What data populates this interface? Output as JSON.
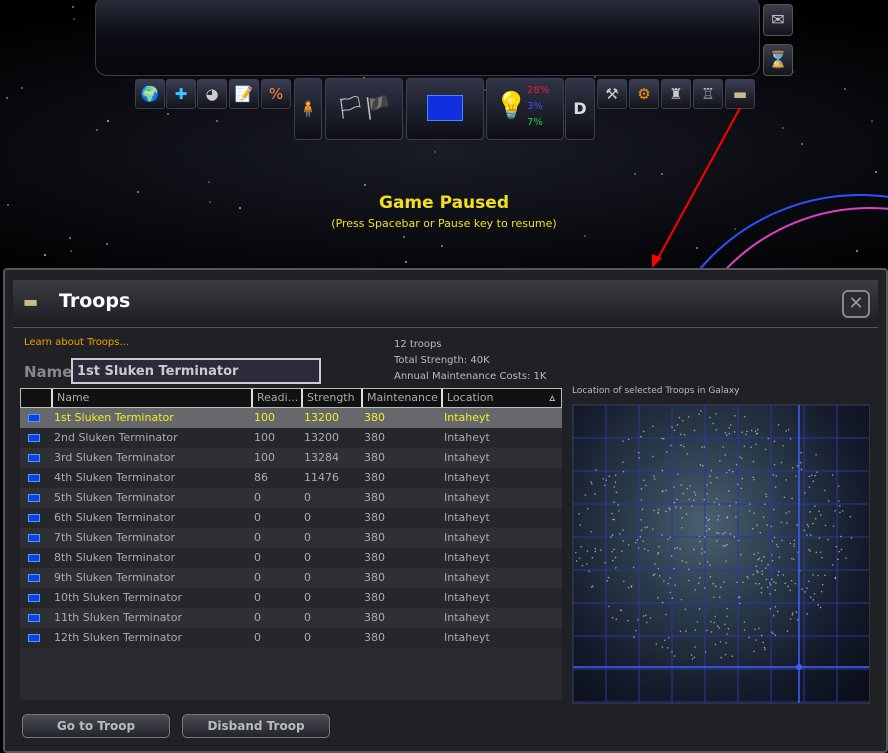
{
  "hud": {
    "resources": [
      {
        "value": "28%",
        "color": "#e02040"
      },
      {
        "value": "3%",
        "color": "#4050ff"
      },
      {
        "value": "7%",
        "color": "#20d040"
      }
    ],
    "paused_title": "Game Paused",
    "paused_hint": "(Press Spacebar or Pause key to resume)"
  },
  "dialog": {
    "title": "Troops",
    "close_label": "✕",
    "learn_link": "Learn about Troops...",
    "stats": [
      "12 troops",
      "Total Strength: 40K",
      "Annual Maintenance Costs: 1K"
    ],
    "name_label": "Name",
    "name_value": "1st Sluken Terminator",
    "columns": [
      "Name",
      "Readi...",
      "Strength",
      "Maintenance",
      "Location"
    ],
    "sort_indicator": "▵",
    "rows": [
      {
        "name": "1st Sluken Terminator",
        "readiness": "100",
        "strength": "13200",
        "maintenance": "380",
        "location": "Intaheyt"
      },
      {
        "name": "2nd Sluken Terminator",
        "readiness": "100",
        "strength": "13200",
        "maintenance": "380",
        "location": "Intaheyt"
      },
      {
        "name": "3rd Sluken Terminator",
        "readiness": "100",
        "strength": "13284",
        "maintenance": "380",
        "location": "Intaheyt"
      },
      {
        "name": "4th Sluken Terminator",
        "readiness": "86",
        "strength": "11476",
        "maintenance": "380",
        "location": "Intaheyt"
      },
      {
        "name": "5th Sluken Terminator",
        "readiness": "0",
        "strength": "0",
        "maintenance": "380",
        "location": "Intaheyt"
      },
      {
        "name": "6th Sluken Terminator",
        "readiness": "0",
        "strength": "0",
        "maintenance": "380",
        "location": "Intaheyt"
      },
      {
        "name": "7th Sluken Terminator",
        "readiness": "0",
        "strength": "0",
        "maintenance": "380",
        "location": "Intaheyt"
      },
      {
        "name": "8th Sluken Terminator",
        "readiness": "0",
        "strength": "0",
        "maintenance": "380",
        "location": "Intaheyt"
      },
      {
        "name": "9th Sluken Terminator",
        "readiness": "0",
        "strength": "0",
        "maintenance": "380",
        "location": "Intaheyt"
      },
      {
        "name": "10th Sluken Terminator",
        "readiness": "0",
        "strength": "0",
        "maintenance": "380",
        "location": "Intaheyt"
      },
      {
        "name": "11th Sluken Terminator",
        "readiness": "0",
        "strength": "0",
        "maintenance": "380",
        "location": "Intaheyt"
      },
      {
        "name": "12th Sluken Terminator",
        "readiness": "0",
        "strength": "0",
        "maintenance": "380",
        "location": "Intaheyt"
      }
    ],
    "map_label": "Location of selected Troops in Galaxy",
    "go_button": "Go to Troop",
    "disband_button": "Disband Troop"
  }
}
